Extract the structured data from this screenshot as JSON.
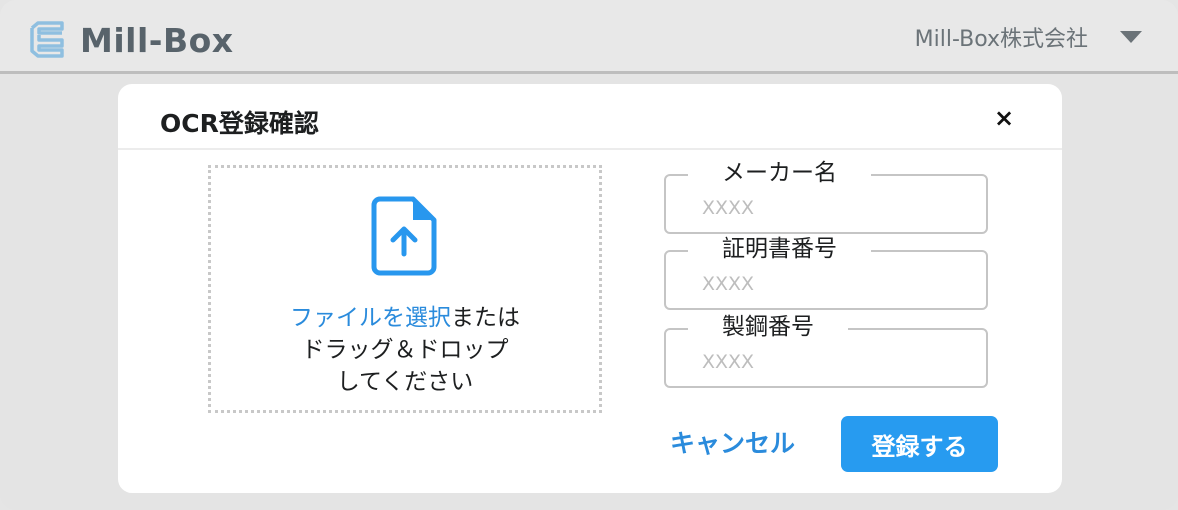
{
  "header": {
    "logo_text": "Mill-Box",
    "company_name": "Mill-Box株式会社",
    "menu_icon": "chevron-down-icon"
  },
  "modal": {
    "title": "OCR登録確認",
    "close_label": "×",
    "dropzone": {
      "icon": "file-upload-icon",
      "link_text": "ファイルを選択",
      "text_suffix": "または",
      "line2": "ドラッグ＆ドロップ",
      "line3": "してください"
    },
    "fields": [
      {
        "label": "メーカー名",
        "placeholder": "XXXX",
        "value": ""
      },
      {
        "label": "証明書番号",
        "placeholder": "XXXX",
        "value": ""
      },
      {
        "label": "製鋼番号",
        "placeholder": "XXXX",
        "value": ""
      }
    ],
    "cancel_label": "キャンセル",
    "submit_label": "登録する"
  },
  "colors": {
    "accent": "#279bf0",
    "link": "#2a8bdc",
    "logo": "#58636b"
  }
}
